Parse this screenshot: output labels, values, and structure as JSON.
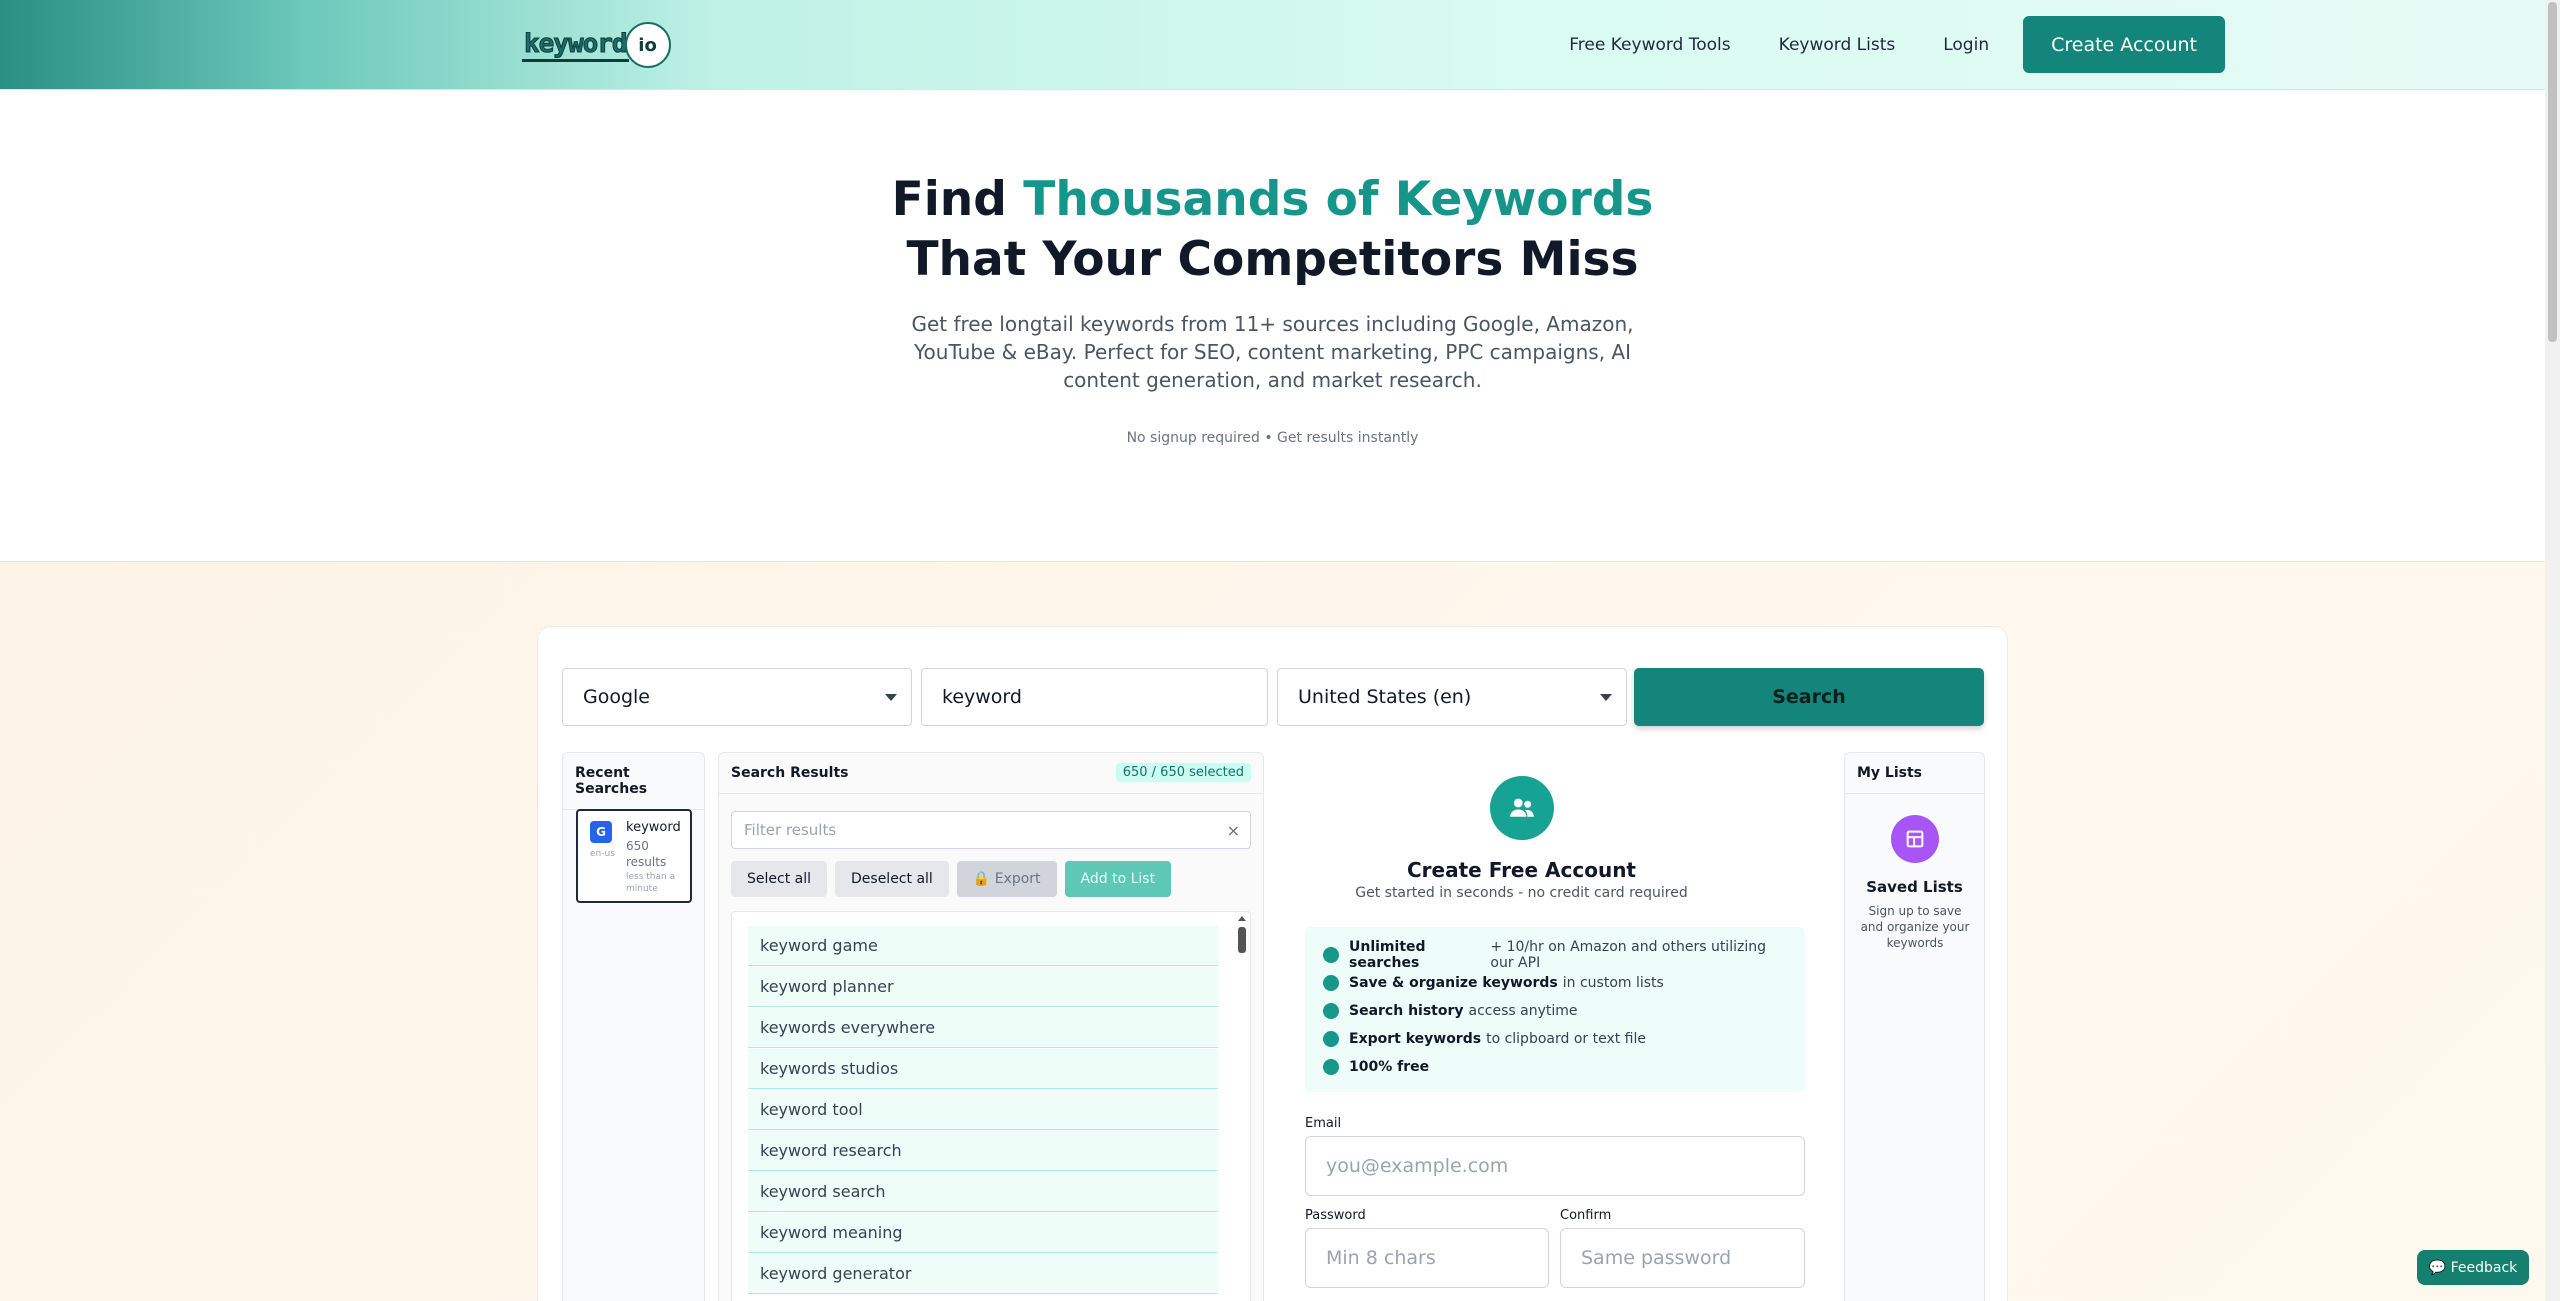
{
  "brand": {
    "logo_word": "keyword",
    "logo_io": "io"
  },
  "nav": {
    "items": [
      "Free Keyword Tools",
      "Keyword Lists",
      "Login"
    ],
    "cta": "Create Account"
  },
  "hero": {
    "title_part1": "Find ",
    "title_accent": "Thousands of Keywords",
    "title_line2": "That Your Competitors Miss",
    "subtitle": "Get free longtail keywords from 11+ sources including Google, Amazon, YouTube & eBay. Perfect for SEO, content marketing, PPC campaigns, AI content generation, and market research.",
    "note": "No signup required • Get results instantly"
  },
  "search": {
    "source": "Google",
    "keyword": "keyword",
    "country": "United States (en)",
    "button": "Search"
  },
  "recent": {
    "heading": "Recent Searches",
    "item": {
      "badge": "G",
      "location": "en-us",
      "keyword": "keyword",
      "count": "650 results",
      "time": "less than a minute"
    }
  },
  "results": {
    "heading": "Search Results",
    "count_badge": "650 / 650 selected",
    "filter_placeholder": "Filter results",
    "clear_icon": "×",
    "buttons": [
      "Select all",
      "Deselect all",
      "🔒 Export",
      "Add to List"
    ],
    "items": [
      "keyword game",
      "keyword planner",
      "keywords everywhere",
      "keywords studios",
      "keyword tool",
      "keyword research",
      "keyword search",
      "keyword meaning",
      "keyword generator"
    ]
  },
  "account": {
    "title": "Create Free Account",
    "subtitle": "Get started in seconds - no credit card required",
    "features": [
      {
        "bold": "Unlimited searches",
        "rest": "+ 10/hr on Amazon and others utilizing our API"
      },
      {
        "bold": "Save & organize keywords",
        "rest": "in custom lists"
      },
      {
        "bold": "Search history",
        "rest": "access anytime"
      },
      {
        "bold": "Export keywords",
        "rest": "to clipboard or text file"
      },
      {
        "bold": "100% free",
        "rest": ""
      }
    ],
    "email_label": "Email",
    "email_placeholder": "you@example.com",
    "password_label": "Password",
    "password_placeholder": "Min 8 chars",
    "confirm_label": "Confirm",
    "confirm_placeholder": "Same password"
  },
  "my_lists": {
    "heading": "My Lists",
    "title": "Saved Lists",
    "subtitle": "Sign up to save and organize your keywords"
  },
  "feedback": "💬 Feedback",
  "colors": {
    "primary": "#13857a",
    "accent_text": "#16958a",
    "purple": "#a855f7"
  }
}
